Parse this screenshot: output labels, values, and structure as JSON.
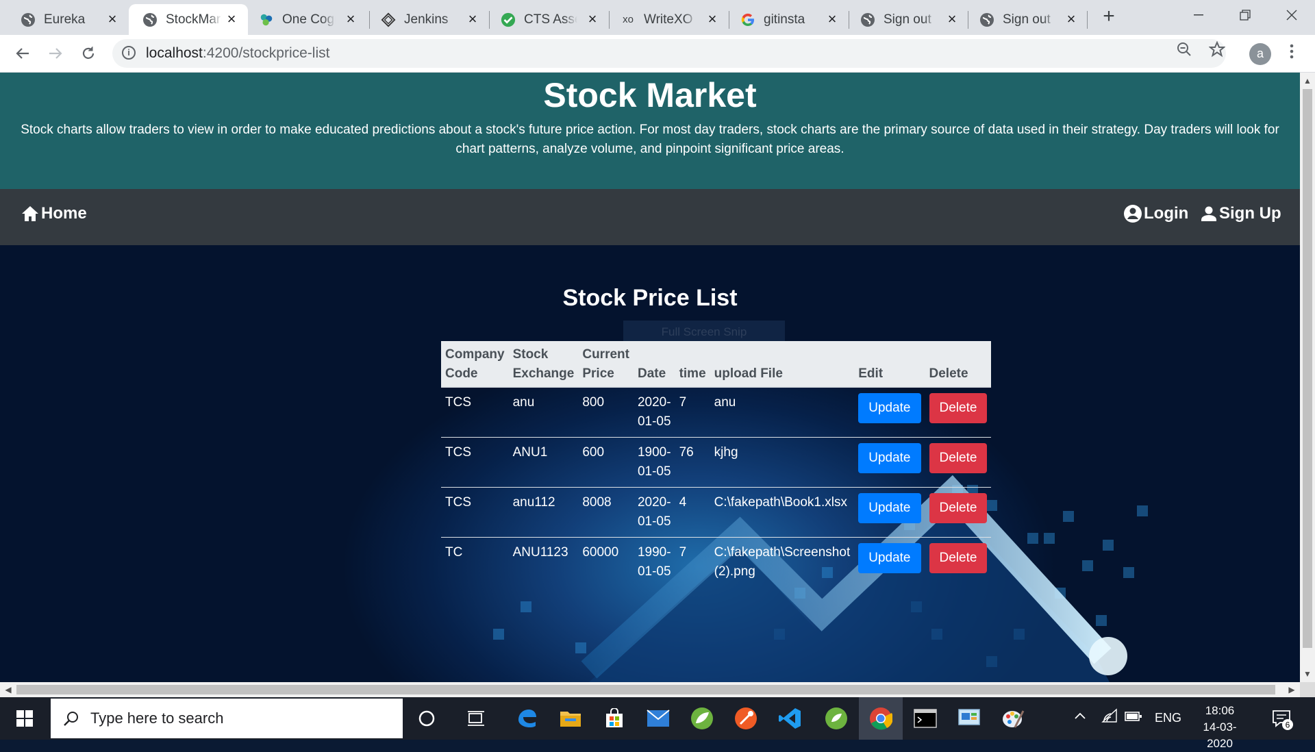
{
  "browser": {
    "tabs": [
      {
        "title": "Eureka",
        "icon": "globe-icon",
        "active": false
      },
      {
        "title": "StockMarket",
        "icon": "globe-icon",
        "active": true
      },
      {
        "title": "One Cognizant",
        "icon": "cognizant-icon",
        "active": false
      },
      {
        "title": "Jenkins",
        "icon": "jenkins-icon",
        "active": false
      },
      {
        "title": "CTS Assessment",
        "icon": "check-circle-icon",
        "active": false
      },
      {
        "title": "WriteXO",
        "icon": "xo-icon",
        "active": false
      },
      {
        "title": "gitinsta",
        "icon": "google-icon",
        "active": false
      },
      {
        "title": "Sign out",
        "icon": "globe-icon",
        "active": false
      },
      {
        "title": "Sign out",
        "icon": "globe-icon",
        "active": false
      }
    ],
    "xo_favicon_text": "xo",
    "new_tab": "+",
    "url_host": "localhost",
    "url_path": ":4200/stockprice-list",
    "profile_initial": "a"
  },
  "hero": {
    "title": "Stock Market",
    "description": "Stock charts allow traders to view in order to make educated predictions about a stock's future price action. For most day traders, stock charts are the primary source of data used in their strategy. Day traders will look for chart patterns, analyze volume, and pinpoint significant price areas."
  },
  "nav": {
    "home": "Home",
    "login": "Login",
    "signup": "Sign Up"
  },
  "page": {
    "title": "Stock Price List",
    "ghost_text": "Full Screen Snip"
  },
  "table": {
    "headers": {
      "company_code": [
        "Company",
        "Code"
      ],
      "stock_exchange": [
        "Stock",
        "Exchange"
      ],
      "current_price": [
        "Current",
        "Price"
      ],
      "date": "Date",
      "time": "time",
      "upload_file": "upload File",
      "edit": "Edit",
      "delete": "Delete"
    },
    "update_label": "Update",
    "delete_label": "Delete",
    "rows": [
      {
        "company": "TCS",
        "exchange": "anu",
        "price": "800",
        "date": [
          "2020-",
          "01-05"
        ],
        "time": "7",
        "file": [
          "anu",
          ""
        ]
      },
      {
        "company": "TCS",
        "exchange": "ANU1",
        "price": "600",
        "date": [
          "1900-",
          "01-05"
        ],
        "time": "76",
        "file": [
          "kjhg",
          ""
        ]
      },
      {
        "company": "TCS",
        "exchange": "anu112",
        "price": "8008",
        "date": [
          "2020-",
          "01-05"
        ],
        "time": "4",
        "file": [
          "C:\\fakepath\\Book1.xlsx",
          ""
        ]
      },
      {
        "company": "TC",
        "exchange": "ANU1123",
        "price": "60000",
        "date": [
          "1990-",
          "01-05"
        ],
        "time": "7",
        "file": [
          "C:\\fakepath\\Screenshot",
          "(2).png"
        ]
      }
    ]
  },
  "taskbar": {
    "search_placeholder": "Type here to search",
    "language": "ENG",
    "time": "18:06",
    "date": "14-03-2020",
    "notification_count": "6"
  },
  "colors": {
    "hero_bg": "#1f6368",
    "navbar_bg": "#343a40",
    "update_btn": "#007bff",
    "delete_btn": "#dc3545",
    "table_header_bg": "#e9ecef"
  }
}
